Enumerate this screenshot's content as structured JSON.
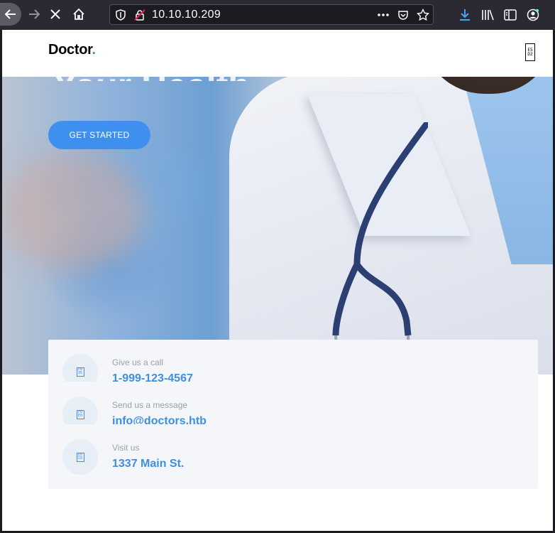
{
  "browser": {
    "url": "10.10.10.209",
    "icons": [
      "back-icon",
      "forward-icon",
      "stop-icon",
      "home-icon",
      "shield-icon",
      "insecure-lock-icon",
      "more-icon",
      "pocket-icon",
      "bookmark-star-icon",
      "download-icon",
      "library-icon",
      "sidebar-icon",
      "account-icon"
    ]
  },
  "site": {
    "logo_text": "Doctor",
    "logo_dot": ".",
    "menu_toggle_glyph": "E5\nD2",
    "hero_title_partial": "Your Health",
    "cta_label": "GET STARTED",
    "contacts": [
      {
        "label": "Give us a call",
        "value": "1-999-123-4567",
        "glyph": "F0\n95"
      },
      {
        "label": "Send us a message",
        "value": "info@doctors.htb",
        "glyph": "F0\nE0"
      },
      {
        "label": "Visit us",
        "value": "1337 Main St.",
        "glyph": "E0\nC8"
      }
    ]
  },
  "colors": {
    "accent": "#3f8fed",
    "chrome_bg": "#2b2a33",
    "urlbar_bg": "#1c1b22"
  }
}
